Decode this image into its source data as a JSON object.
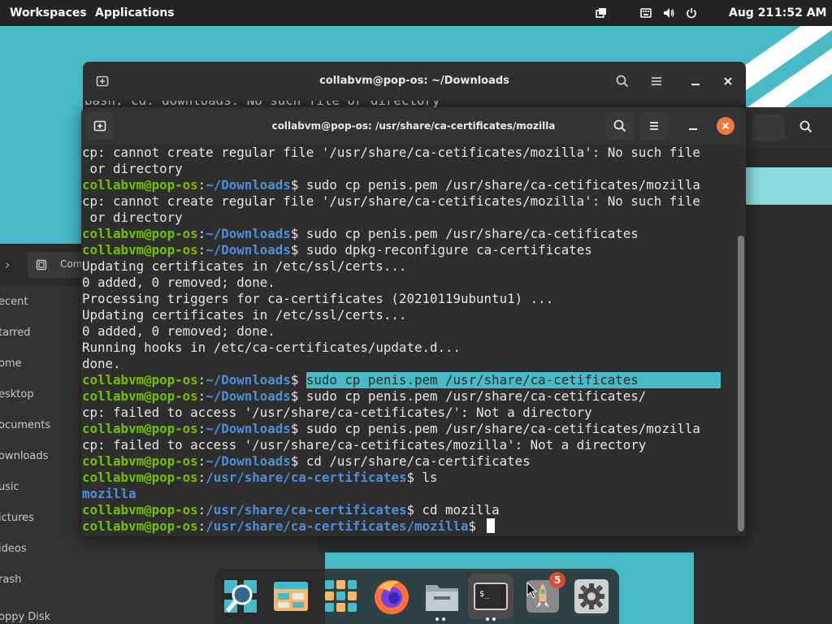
{
  "topbar": {
    "workspaces": "Workspaces",
    "applications": "Applications",
    "date": "Aug 21",
    "time": "1:52 AM",
    "icons": [
      "windows-icon",
      "keyboard-icon",
      "volume-icon",
      "power-icon"
    ]
  },
  "file_manager": {
    "address_fragment": "Com",
    "sidebar": [
      "ecent",
      "tarred",
      "ome",
      "esktop",
      "ocuments",
      "ownloads",
      "usic",
      "ictures",
      "ideos",
      "rash",
      "oppy Disk"
    ]
  },
  "back_terminal": {
    "title": "collabvm@pop-os: ~/Downloads",
    "peek_text": "bash: cd: downloads: No such file or directory"
  },
  "front_terminal": {
    "title": "collabvm@pop-os: /usr/share/ca-certificates/mozilla",
    "lines": [
      {
        "type": "out",
        "text": "cp: cannot create regular file '/usr/share/ca-cetificates/mozilla': No such file"
      },
      {
        "type": "out",
        "text": " or directory"
      },
      {
        "type": "cmd",
        "user": "collabvm@pop-os",
        "path": "~/Downloads",
        "cmd": "sudo cp penis.pem /usr/share/ca-cetificates/mozilla"
      },
      {
        "type": "out",
        "text": "cp: cannot create regular file '/usr/share/ca-cetificates/mozilla': No such file"
      },
      {
        "type": "out",
        "text": " or directory"
      },
      {
        "type": "cmd",
        "user": "collabvm@pop-os",
        "path": "~/Downloads",
        "cmd": "sudo cp penis.pem /usr/share/ca-cetificates"
      },
      {
        "type": "cmd",
        "user": "collabvm@pop-os",
        "path": "~/Downloads",
        "cmd": "sudo dpkg-reconfigure ca-certificates"
      },
      {
        "type": "out",
        "text": "Updating certificates in /etc/ssl/certs..."
      },
      {
        "type": "out",
        "text": "0 added, 0 removed; done."
      },
      {
        "type": "out",
        "text": "Processing triggers for ca-certificates (20210119ubuntu1) ..."
      },
      {
        "type": "out",
        "text": "Updating certificates in /etc/ssl/certs..."
      },
      {
        "type": "out",
        "text": "0 added, 0 removed; done."
      },
      {
        "type": "out",
        "text": "Running hooks in /etc/ca-certificates/update.d..."
      },
      {
        "type": "out",
        "text": "done."
      },
      {
        "type": "cmd",
        "user": "collabvm@pop-os",
        "path": "~/Downloads",
        "cmd": "sudo cp penis.pem /usr/share/ca-cetificates",
        "highlight": true
      },
      {
        "type": "cmd",
        "user": "collabvm@pop-os",
        "path": "~/Downloads",
        "cmd": "sudo cp penis.pem /usr/share/ca-cetificates/"
      },
      {
        "type": "out",
        "text": "cp: failed to access '/usr/share/ca-cetificates/': Not a directory"
      },
      {
        "type": "cmd",
        "user": "collabvm@pop-os",
        "path": "~/Downloads",
        "cmd": "sudo cp penis.pem /usr/share/ca-cetificates/mozilla"
      },
      {
        "type": "out",
        "text": "cp: failed to access '/usr/share/ca-cetificates/mozilla': Not a directory"
      },
      {
        "type": "cmd",
        "user": "collabvm@pop-os",
        "path": "~/Downloads",
        "cmd": "cd /usr/share/ca-certificates"
      },
      {
        "type": "cmd",
        "user": "collabvm@pop-os",
        "path": "/usr/share/ca-certificates",
        "cmd": "ls"
      },
      {
        "type": "dir",
        "text": "mozilla"
      },
      {
        "type": "cmd",
        "user": "collabvm@pop-os",
        "path": "/usr/share/ca-certificates",
        "cmd": "cd mozilla"
      },
      {
        "type": "cmd",
        "user": "collabvm@pop-os",
        "path": "/usr/share/ca-certificates/mozilla",
        "cmd": "",
        "cursor": true
      }
    ]
  },
  "dock": {
    "items": [
      "search-app-icon",
      "file-manager-app-icon",
      "app-grid-icon",
      "firefox-icon",
      "files-icon",
      "terminal-icon",
      "pop-shop-icon",
      "settings-icon"
    ],
    "shop_badge": "5",
    "terminal_glyph": "$_"
  },
  "colors": {
    "accent": "#48b9c7",
    "user": "#73c000",
    "path": "#4f8fd8",
    "close": "#f2763e"
  }
}
